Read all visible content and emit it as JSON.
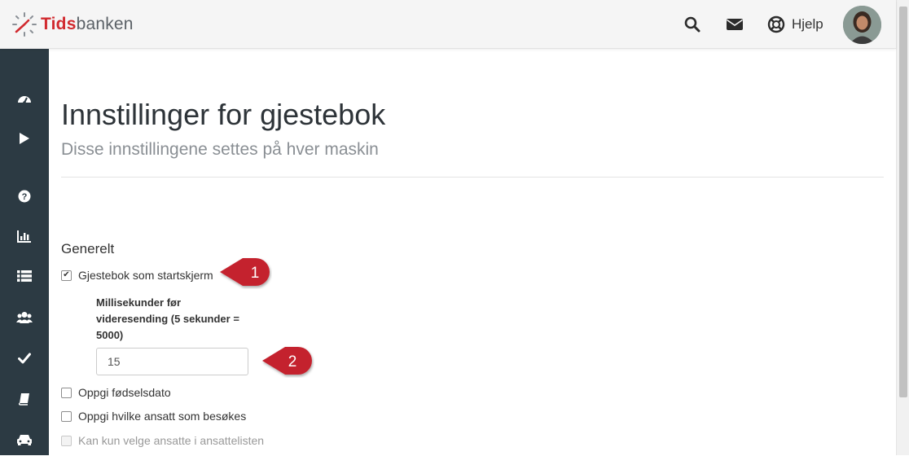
{
  "header": {
    "logo_part1": "Tids",
    "logo_part2": "banken",
    "help_label": "Hjelp",
    "icons": [
      "search-icon",
      "envelope-icon",
      "life-ring-icon"
    ]
  },
  "sidebar": {
    "items": [
      {
        "icon": "dashboard-icon"
      },
      {
        "icon": "play-icon"
      },
      {
        "icon": "question-circle-icon"
      },
      {
        "icon": "bar-chart-icon"
      },
      {
        "icon": "list-icon"
      },
      {
        "icon": "users-icon"
      },
      {
        "icon": "check-icon"
      },
      {
        "icon": "book-icon"
      },
      {
        "icon": "car-icon"
      }
    ]
  },
  "page": {
    "title": "Innstillinger for gjestebok",
    "subtitle": "Disse innstillingene settes på hver maskin",
    "section_title": "Generelt"
  },
  "settings": {
    "start_screen": {
      "label": "Gjestebok som startskjerm",
      "checked": true
    },
    "delay_field": {
      "label": "Millisekunder før videresending (5 sekunder = 5000)",
      "value": "15"
    },
    "birthdate": {
      "label": "Oppgi fødselsdato",
      "checked": false
    },
    "employee": {
      "label": "Oppgi hvilke ansatt som besøkes",
      "checked": false
    },
    "employee_list_only": {
      "label": "Kan kun velge ansatte i ansattelisten",
      "checked": false,
      "disabled": true
    }
  },
  "callouts": {
    "one": "1",
    "two": "2"
  },
  "colors": {
    "brand_red": "#d12a2f",
    "sidebar_bg": "#2c3a43",
    "callout_red": "#c4232e"
  }
}
